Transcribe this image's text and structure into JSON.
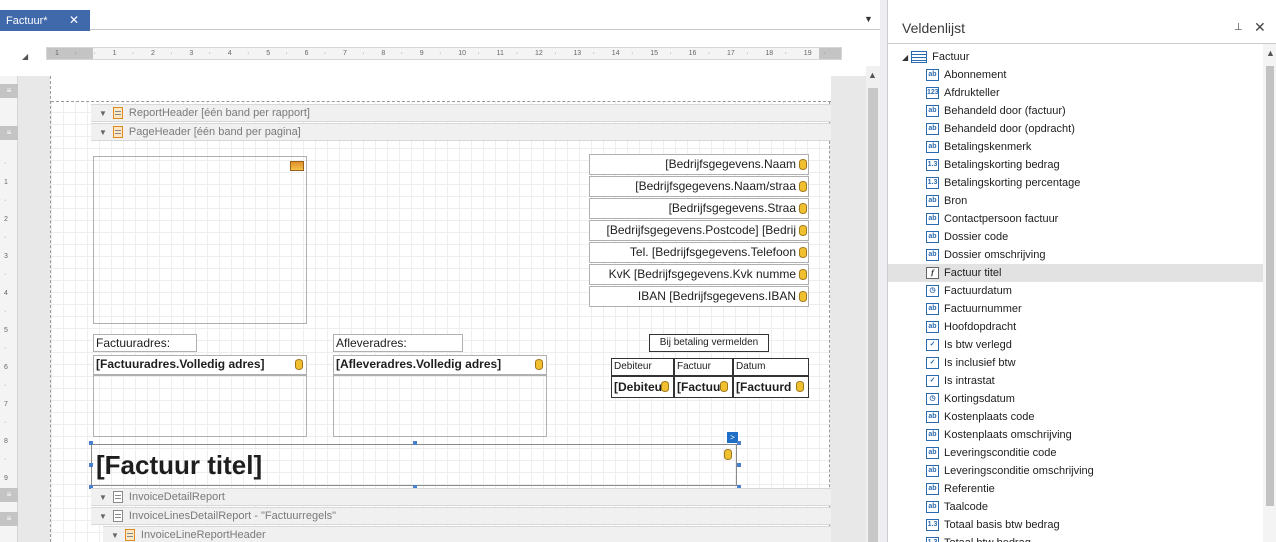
{
  "tab": {
    "title": "Factuur*",
    "close": "✕",
    "dropdown": "▼"
  },
  "ruler": {
    "corner": "◢",
    "ticks": [
      "1",
      "·",
      "·",
      "1",
      "·",
      "2",
      "·",
      "3",
      "·",
      "4",
      "·",
      "5",
      "·",
      "6",
      "·",
      "7",
      "·",
      "8",
      "·",
      "9",
      "·",
      "10",
      "·",
      "11",
      "·",
      "12",
      "·",
      "13",
      "·",
      "14",
      "·",
      "15",
      "·",
      "16",
      "·",
      "17",
      "·",
      "18",
      "·",
      "19",
      "·"
    ],
    "vticks": [
      "·",
      "1",
      "·",
      "2",
      "·",
      "3",
      "·",
      "4",
      "·",
      "5",
      "·",
      "6",
      "·",
      "7",
      "·",
      "8",
      "·",
      "9"
    ],
    "grip": "≡"
  },
  "bands": {
    "report_header": "ReportHeader [één band per rapport]",
    "page_header": "PageHeader [één band per pagina]",
    "invoice_detail": "InvoiceDetailReport",
    "invoice_lines_detail": "InvoiceLinesDetailReport - \"Factuurregels\"",
    "invoice_line_header": "InvoiceLineReportHeader"
  },
  "company_fields": [
    "[Bedrijfsgegevens.Naam",
    "[Bedrijfsgegevens.Naam/straa",
    "[Bedrijfsgegevens.Straa",
    "[Bedrijfsgegevens.Postcode]  [Bedrij",
    "Tel. [Bedrijfsgegevens.Telefoon",
    "KvK [Bedrijfsgegevens.Kvk numme",
    "IBAN [Bedrijfsgegevens.IBAN"
  ],
  "address": {
    "invoice_label": "Factuuradres:",
    "invoice_value": "[Factuuradres.Volledig adres]",
    "delivery_label": "Afleveradres:",
    "delivery_value": "[Afleveradres.Volledig adres]"
  },
  "payment": {
    "caption": "Bij betaling vermelden",
    "headers": [
      "Debiteur",
      "Factuur",
      "Datum"
    ],
    "values": [
      "[Debiteu",
      "[Factuu",
      "[Factuurd"
    ]
  },
  "title_field": "[Factuur titel]",
  "smart_tag": ">",
  "scroll_up": "▲",
  "fieldlist": {
    "title": "Veldenlijst",
    "pin": "⊥",
    "close": "✕",
    "root_expander": "◢",
    "root_label": "Factuur",
    "items": [
      {
        "label": "Abonnement",
        "icon": "ab"
      },
      {
        "label": "Afdrukteller",
        "icon": "123"
      },
      {
        "label": "Behandeld door (factuur)",
        "icon": "ab"
      },
      {
        "label": "Behandeld door (opdracht)",
        "icon": "ab"
      },
      {
        "label": "Betalingskenmerk",
        "icon": "ab"
      },
      {
        "label": "Betalingskorting bedrag",
        "icon": "1.3"
      },
      {
        "label": "Betalingskorting percentage",
        "icon": "1.3"
      },
      {
        "label": "Bron",
        "icon": "ab"
      },
      {
        "label": "Contactpersoon factuur",
        "icon": "ab"
      },
      {
        "label": "Dossier code",
        "icon": "ab"
      },
      {
        "label": "Dossier omschrijving",
        "icon": "ab"
      },
      {
        "label": "Factuur titel",
        "icon": "f"
      },
      {
        "label": "Factuurdatum",
        "icon": "◷"
      },
      {
        "label": "Factuurnummer",
        "icon": "ab"
      },
      {
        "label": "Hoofdopdracht",
        "icon": "ab"
      },
      {
        "label": "Is btw verlegd",
        "icon": "✓"
      },
      {
        "label": "Is inclusief btw",
        "icon": "✓"
      },
      {
        "label": "Is intrastat",
        "icon": "✓"
      },
      {
        "label": "Kortingsdatum",
        "icon": "◷"
      },
      {
        "label": "Kostenplaats code",
        "icon": "ab"
      },
      {
        "label": "Kostenplaats omschrijving",
        "icon": "ab"
      },
      {
        "label": "Leveringsconditie code",
        "icon": "ab"
      },
      {
        "label": "Leveringsconditie omschrijving",
        "icon": "ab"
      },
      {
        "label": "Referentie",
        "icon": "ab"
      },
      {
        "label": "Taalcode",
        "icon": "ab"
      },
      {
        "label": "Totaal basis btw bedrag",
        "icon": "1.3"
      },
      {
        "label": "Totaal btw bedrag",
        "icon": "1.3"
      }
    ]
  }
}
